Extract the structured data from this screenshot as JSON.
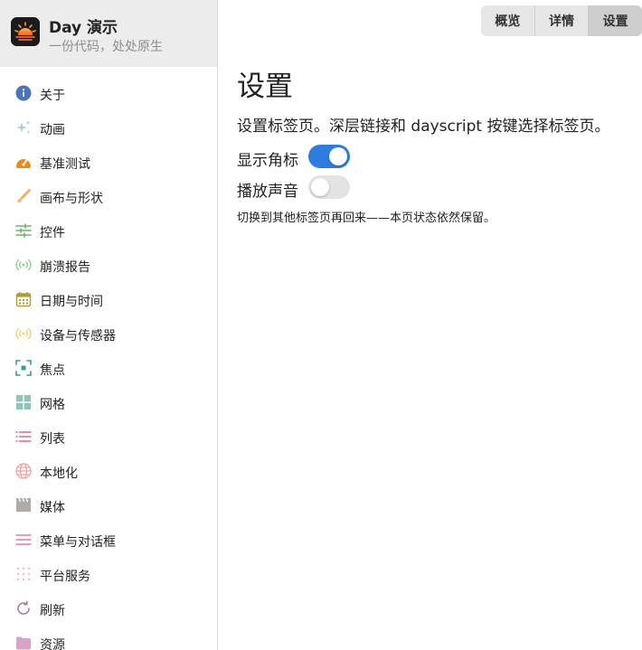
{
  "app": {
    "name": "Day 演示",
    "tagline": "一份代码，处处原生"
  },
  "sidebar": {
    "items": [
      {
        "label": "关于",
        "icon": "info-icon"
      },
      {
        "label": "动画",
        "icon": "sparkles-icon"
      },
      {
        "label": "基准测试",
        "icon": "gauge-icon"
      },
      {
        "label": "画布与形状",
        "icon": "paintbrush-icon"
      },
      {
        "label": "控件",
        "icon": "sliders-icon"
      },
      {
        "label": "崩溃报告",
        "icon": "broadcast-icon"
      },
      {
        "label": "日期与时间",
        "icon": "calendar-icon"
      },
      {
        "label": "设备与传感器",
        "icon": "sensor-icon"
      },
      {
        "label": "焦点",
        "icon": "focus-icon"
      },
      {
        "label": "网格",
        "icon": "grid-icon"
      },
      {
        "label": "列表",
        "icon": "list-icon"
      },
      {
        "label": "本地化",
        "icon": "globe-icon"
      },
      {
        "label": "媒体",
        "icon": "film-icon"
      },
      {
        "label": "菜单与对话框",
        "icon": "menu-icon"
      },
      {
        "label": "平台服务",
        "icon": "dots-grid-icon"
      },
      {
        "label": "刷新",
        "icon": "refresh-icon"
      },
      {
        "label": "资源",
        "icon": "folder-icon"
      }
    ]
  },
  "tabs": [
    {
      "label": "概览",
      "active": false
    },
    {
      "label": "详情",
      "active": false
    },
    {
      "label": "设置",
      "active": true
    }
  ],
  "main": {
    "title": "设置",
    "description": "设置标签页。深层链接和 dayscript 按键选择标签页。",
    "settings": [
      {
        "label": "显示角标",
        "enabled": true
      },
      {
        "label": "播放声音",
        "enabled": false
      }
    ],
    "note": "切换到其他标签页再回来——本页状态依然保留。"
  },
  "colors": {
    "accent": "#2d7ce0",
    "sidebar_header_bg": "#ececec",
    "toggle_off": "#e3e3e3"
  }
}
